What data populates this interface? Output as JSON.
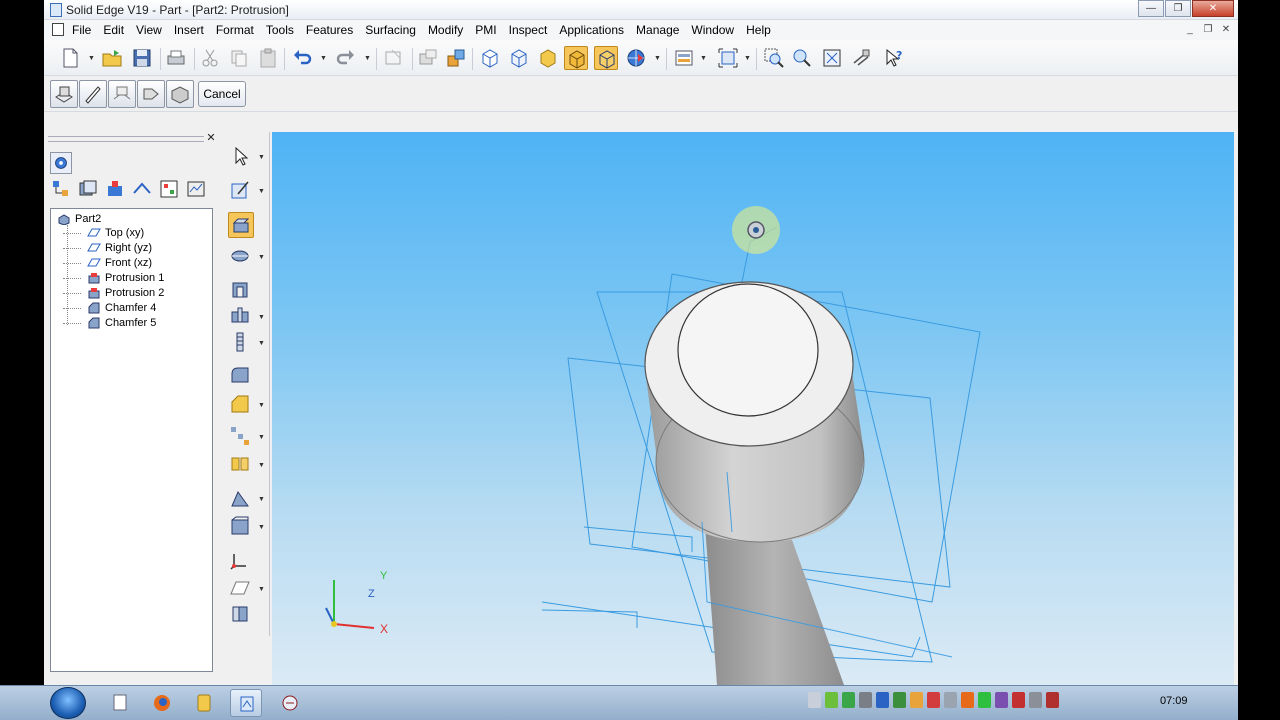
{
  "window": {
    "title": "Solid Edge V19 - Part - [Part2: Protrusion]",
    "controls": [
      "minimize",
      "restore",
      "close"
    ]
  },
  "menubar": {
    "items": [
      "File",
      "Edit",
      "View",
      "Insert",
      "Format",
      "Tools",
      "Features",
      "Surfacing",
      "Modify",
      "PMI",
      "Inspect",
      "Applications",
      "Manage",
      "Window",
      "Help"
    ]
  },
  "command_bar": {
    "cancel_label": "Cancel"
  },
  "pathfinder": {
    "root": "Part2",
    "items": [
      {
        "label": "Top (xy)",
        "icon": "reference-plane-icon"
      },
      {
        "label": "Right (yz)",
        "icon": "reference-plane-icon"
      },
      {
        "label": "Front (xz)",
        "icon": "reference-plane-icon"
      },
      {
        "label": "Protrusion 1",
        "icon": "protrusion-icon"
      },
      {
        "label": "Protrusion 2",
        "icon": "protrusion-icon"
      },
      {
        "label": "Chamfer 4",
        "icon": "chamfer-icon"
      },
      {
        "label": "Chamfer 5",
        "icon": "chamfer-icon"
      }
    ]
  },
  "viewport": {
    "triad_x": "X",
    "triad_y": "Y",
    "triad_z": "Z",
    "background_top": "#4fb3f5",
    "background_bottom": "#dbeaf5",
    "plane_color": "#3a9be0",
    "body_color": "#b8b8b8"
  },
  "taskbar": {
    "clock": "07:09"
  }
}
